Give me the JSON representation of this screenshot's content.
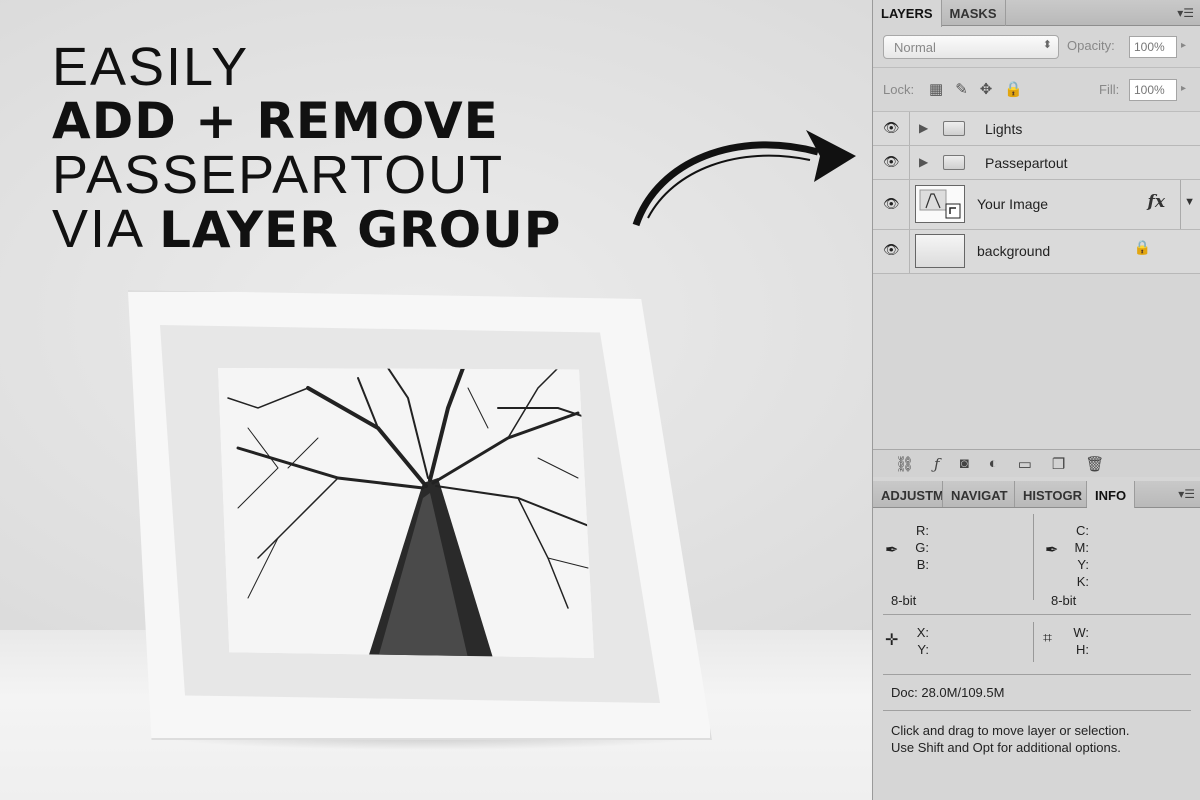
{
  "headline": {
    "line1": "EASILY",
    "line2": "ADD + REMOVE",
    "line3": "PASSEPARTOUT",
    "line4_prefix": "VIA ",
    "line4_bold": "LAYER GROUP"
  },
  "layers_panel": {
    "tabs": [
      "LAYERS",
      "MASKS"
    ],
    "blend_mode": "Normal",
    "opacity_label": "Opacity:",
    "opacity_value": "100%",
    "lock_label": "Lock:",
    "fill_label": "Fill:",
    "fill_value": "100%",
    "layers": [
      {
        "name": "Lights",
        "kind": "group"
      },
      {
        "name": "Passepartout",
        "kind": "group"
      },
      {
        "name": "Your Image",
        "kind": "smart-object",
        "fx": "fx"
      },
      {
        "name": "background",
        "kind": "locked"
      }
    ]
  },
  "info_panel": {
    "tabs": [
      "ADJUSTM",
      "NAVIGAT",
      "HISTOGR",
      "INFO"
    ],
    "rgb_labels": [
      "R:",
      "G:",
      "B:"
    ],
    "cmyk_labels": [
      "C:",
      "M:",
      "Y:",
      "K:"
    ],
    "bit_left": "8-bit",
    "bit_right": "8-bit",
    "xy_labels": [
      "X:",
      "Y:"
    ],
    "wh_labels": [
      "W:",
      "H:"
    ],
    "doc": "Doc: 28.0M/109.5M",
    "hint_line1": "Click and drag to move layer or selection.",
    "hint_line2": "Use Shift and Opt for additional options."
  },
  "colors": {
    "panel_bg": "#d6d6d6",
    "headline": "#111111"
  }
}
